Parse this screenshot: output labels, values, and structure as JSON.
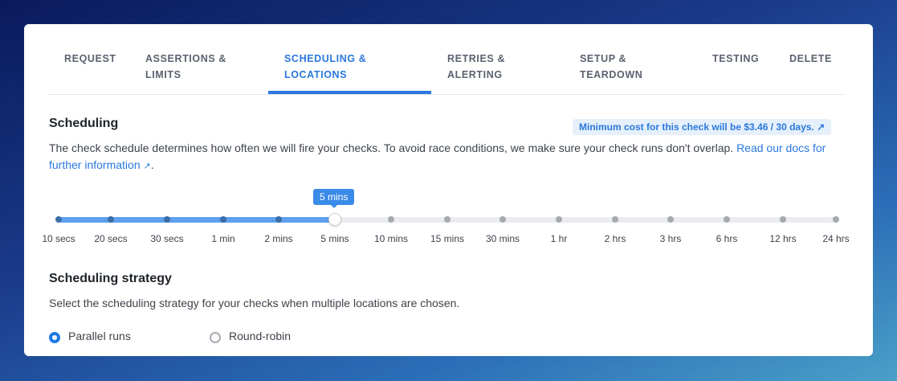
{
  "tabs": [
    {
      "label": "REQUEST",
      "active": false
    },
    {
      "label": "ASSERTIONS & LIMITS",
      "l1": "ASSERTIONS &",
      "l2": "LIMITS",
      "active": false
    },
    {
      "label": "SCHEDULING & LOCATIONS",
      "l1": "SCHEDULING &",
      "l2": "LOCATIONS",
      "active": true
    },
    {
      "label": "RETRIES & ALERTING",
      "l1": "RETRIES &",
      "l2": "ALERTING",
      "active": false
    },
    {
      "label": "SETUP & TEARDOWN",
      "l1": "SETUP &",
      "l2": "TEARDOWN",
      "active": false
    },
    {
      "label": "TESTING",
      "active": false
    },
    {
      "label": "DELETE",
      "active": false
    }
  ],
  "scheduling": {
    "title": "Scheduling",
    "cost_badge": "Minimum cost for this check will be $3.46 / 30 days.",
    "description": "The check schedule determines how often we will fire your checks. To avoid race conditions, we make sure your check runs don't overlap.",
    "link_text": "Read our docs for further information",
    "trailing": "."
  },
  "slider": {
    "options": [
      "10 secs",
      "20 secs",
      "30 secs",
      "1 min",
      "2 mins",
      "5 mins",
      "10 mins",
      "15 mins",
      "30 mins",
      "1 hr",
      "2 hrs",
      "3 hrs",
      "6 hrs",
      "12 hrs",
      "24 hrs"
    ],
    "selected_index": 5,
    "tooltip": "5 mins"
  },
  "strategy": {
    "title": "Scheduling strategy",
    "description": "Select the scheduling strategy for your checks when multiple locations are chosen.",
    "options": [
      {
        "label": "Parallel runs",
        "checked": true
      },
      {
        "label": "Round-robin",
        "checked": false
      }
    ]
  },
  "colors": {
    "accent": "#2a78dc"
  }
}
